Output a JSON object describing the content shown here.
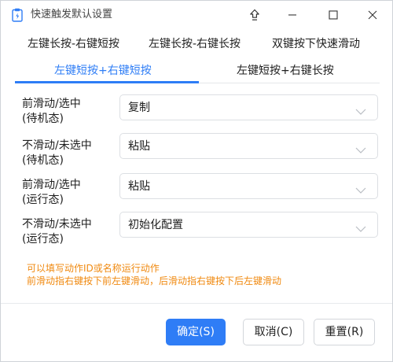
{
  "window": {
    "title": "快速触发默认设置",
    "icons": {
      "app": "clipboard-icon",
      "pin": "pin-icon",
      "minimize": "minimize-icon",
      "maximize": "maximize-icon",
      "close": "close-icon"
    }
  },
  "tabs": {
    "row1": [
      "左键长按-右键短按",
      "左键长按-右键长按",
      "双键按下快速滑动"
    ],
    "row2": [
      "左键短按+右键短按",
      "左键短按+右键长按"
    ],
    "active": "左键短按+右键短按",
    "accent_color": "#2e7df6"
  },
  "settings": [
    {
      "label_line1": "前滑动/选中",
      "label_line2": "(待机态)",
      "value": "复制"
    },
    {
      "label_line1": "不滑动/未选中",
      "label_line2": "(待机态)",
      "value": "粘贴"
    },
    {
      "label_line1": "前滑动/选中",
      "label_line2": "(运行态)",
      "value": "粘贴"
    },
    {
      "label_line1": "不滑动/未选中",
      "label_line2": "(运行态)",
      "value": "初始化配置"
    }
  ],
  "hints": {
    "line1": "可以填写动作ID或名称运行动作",
    "line2": "前滑动指右键按下前左键滑动，后滑动指右键按下后左键滑动",
    "color": "#f08a11"
  },
  "buttons": {
    "ok": "确定(S)",
    "cancel": "取消(C)",
    "reset": "重置(R)",
    "primary_color": "#2f7df6"
  }
}
